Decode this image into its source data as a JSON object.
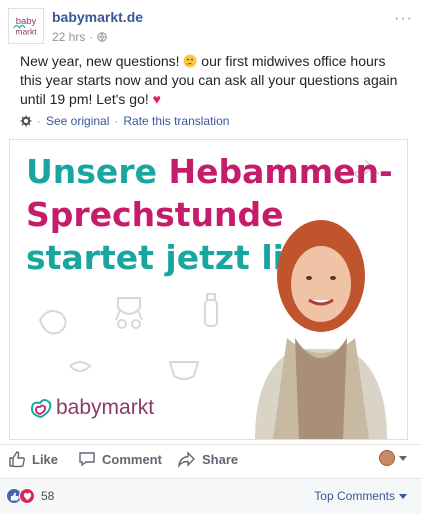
{
  "header": {
    "page_name": "babymarkt.de",
    "time": "22 hrs",
    "dot": "·",
    "more": "···"
  },
  "post": {
    "text_before_emoji": "New year, new questions! ",
    "text_after_emoji": " our first midwives office hours this year starts now and you can ask all your questions again until 19 pm! Let's go! ",
    "heart": "♥"
  },
  "translation": {
    "see_original": "See original",
    "separator": "·",
    "rate": "Rate this translation"
  },
  "image": {
    "headline_line1": "Unsere",
    "headline_line1_b": "Hebammen-",
    "headline_line2": "Sprechstunde",
    "headline_line3": "startet jetzt live!",
    "logo_text": "babymarkt",
    "avatar_logo_top": "baby",
    "avatar_logo_bottom": "markt"
  },
  "actions": {
    "like": "Like",
    "comment": "Comment",
    "share": "Share"
  },
  "footer": {
    "reaction_count": "58",
    "top_comments": "Top Comments"
  },
  "colors": {
    "link": "#365899",
    "teal": "#1aa6a0",
    "pink": "#c51d6b",
    "like_blue": "#4267b2",
    "love_red": "#e0245e"
  }
}
